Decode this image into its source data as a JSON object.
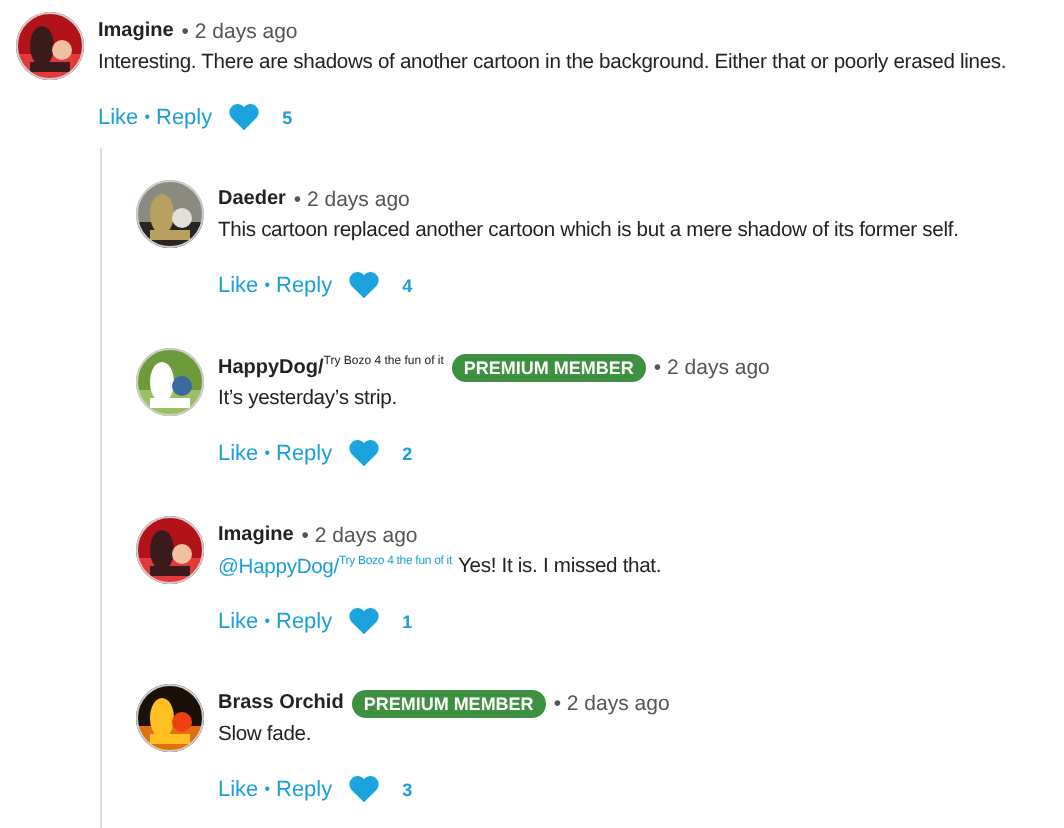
{
  "comment": {
    "name": "Imagine",
    "time": "• 2 days ago",
    "text": "Interesting. There are shadows of another cartoon in the background. Either that or poorly erased lines.",
    "like": "Like",
    "sep": "•",
    "reply": "Reply",
    "count": "5",
    "children": [
      {
        "name": "Daeder",
        "time": "• 2 days ago",
        "text": "This cartoon replaced another cartoon which is but a mere shadow of its former self.",
        "like": "Like",
        "sep": "•",
        "reply": "Reply",
        "count": "4"
      },
      {
        "name": "HappyDog/$^{Try Bozo 4 the fun of it}$",
        "badge": "PREMIUM MEMBER",
        "time": "• 2 days ago",
        "text": "It’s yesterday’s strip.",
        "like": "Like",
        "sep": "•",
        "reply": "Reply",
        "count": "2"
      },
      {
        "name": "Imagine",
        "time": "• 2 days ago",
        "mention": "@HappyDog/$^{Try Bozo 4 the fun of it}$",
        "text": "Yes! It is. I missed that.",
        "like": "Like",
        "sep": "•",
        "reply": "Reply",
        "count": "1"
      },
      {
        "name": "Brass Orchid",
        "badge": "PREMIUM MEMBER",
        "time": "• 2 days ago",
        "text": "Slow fade.",
        "like": "Like",
        "sep": "•",
        "reply": "Reply",
        "count": "3"
      }
    ]
  }
}
